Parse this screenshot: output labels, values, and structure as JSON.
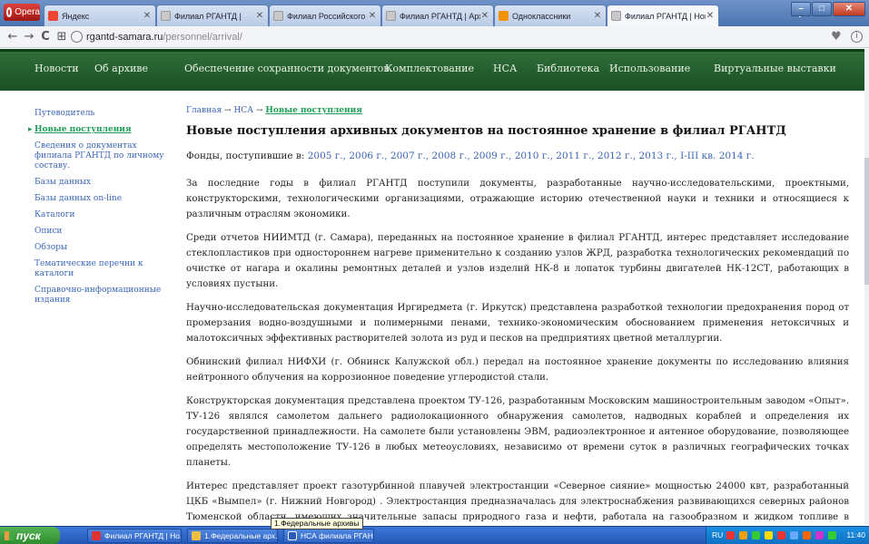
{
  "browser": {
    "menu_label": "Opera",
    "tabs": [
      {
        "title": "Яндекс",
        "icon": "yandex-icon"
      },
      {
        "title": "Филиал РГАНТД |",
        "icon": "page-icon"
      },
      {
        "title": "Филиал Российского гос",
        "icon": "page-icon"
      },
      {
        "title": "Филиал РГАНТД | Архи",
        "icon": "page-icon"
      },
      {
        "title": "Одноклассники",
        "icon": "ok-icon"
      },
      {
        "title": "Филиал РГАНТД | Новые",
        "icon": "page-icon",
        "active": true
      }
    ],
    "url_host": "rgantd-samara.ru",
    "url_path": "/personnel/arrival/"
  },
  "nav": {
    "items": [
      "Новости",
      "Об архиве",
      "Обеспечение сохранности документов",
      "Комплектование",
      "НСА",
      "Библиотека",
      "Использование",
      "Виртуальные выставки"
    ]
  },
  "sidebar": {
    "items": [
      {
        "label": "Путеводитель"
      },
      {
        "label": "Новые поступления",
        "active": true
      },
      {
        "label": "Сведения о документах филиала РГАНТД по личному составу."
      },
      {
        "label": "Базы данных"
      },
      {
        "label": "Базы данных on-line"
      },
      {
        "label": "Каталоги"
      },
      {
        "label": "Описи"
      },
      {
        "label": "Обзоры"
      },
      {
        "label": "Тематические перечни к каталоги"
      },
      {
        "label": "Справочно-информационные издания"
      }
    ]
  },
  "breadcrumb": {
    "home": "Главная",
    "sep": "→",
    "section": "НСА",
    "current": "Новые поступления"
  },
  "page": {
    "title": "Новые поступления архивных документов на постоянное хранение в филиал РГАНТД",
    "funds_label": "Фонды, поступившие в:",
    "years": [
      "2005 г.,",
      "2006 г.,",
      "2007 г.,",
      "2008 г.,",
      "2009 г.,",
      "2010 г.,",
      "2011 г.,",
      "2012 г.,",
      "2013 г.,",
      "I-III кв. 2014 г."
    ],
    "paragraphs": [
      "За последние годы в филиал РГАНТД поступили документы, разработанные научно-исследовательскими, проектными, конструкторскими, технологическими организациями, отражающие историю отечественной науки и техники и относящиеся к различным отраслям экономики.",
      "Среди отчетов НИИМТД (г. Самара), переданных на постоянное хранение в филиал РГАНТД, интерес представляет исследование стеклопластиков при одностороннем нагреве применительно к созданию узлов ЖРД, разработка технологических рекомендаций по очистке от нагара и окалины ремонтных деталей и узлов изделий НК-8 и лопаток турбины двигателей НК-12СТ, работающих в условиях пустыни.",
      "Научно-исследовательская документация Иргиредмета (г. Иркутск) представлена разработкой технологии предохранения пород от промерзания водно-воздушными и полимерными пенами, технико-экономическим обоснованием применения нетоксичных и малотоксичных эффективных растворителей золота из руд и песков на предприятиях цветной металлургии.",
      "Обнинский филиал НИФХИ (г. Обнинск Калужской обл.) передал на постоянное хранение документы по исследованию влияния нейтронного облучения на коррозионное поведение углеродистой стали.",
      "Конструкторская документация представлена проектом ТУ-126, разработанным Московским машиностроительным заводом «Опыт». ТУ-126 являлся самолетом дальнего радиолокационного обнаружения самолетов, надводных кораблей и определения их государственной принадлежности. На самолете были установлены ЭВМ, радиоэлектронное и антенное оборудование, позволяющее определять местоположение ТУ-126 в любых метеоусловиях, независимо от времени суток в различных географических точках планеты.",
      "Интерес представляет проект газотурбинной плавучей электростанции «Северное сияние» мощностью 24000 квт, разработанный ЦКБ «Вымпел» (г. Нижний Новгород) . Электростанция предназначалась для электроснабжения развивающихся северных районов Тюменской области, имеющих значительные запасы природного газа и нефти, работала на газообразном и жидком топливе в условиях морской и"
    ]
  },
  "taskbar": {
    "start_label": "пуск",
    "tasks": [
      "Филиал РГАНТД | Но...",
      "1.Федеральные арх...",
      "НСА филиала РГАНТ..."
    ],
    "tray_lang": "RU",
    "clock": "11:40",
    "tooltip": "1.Федеральные архивы"
  }
}
